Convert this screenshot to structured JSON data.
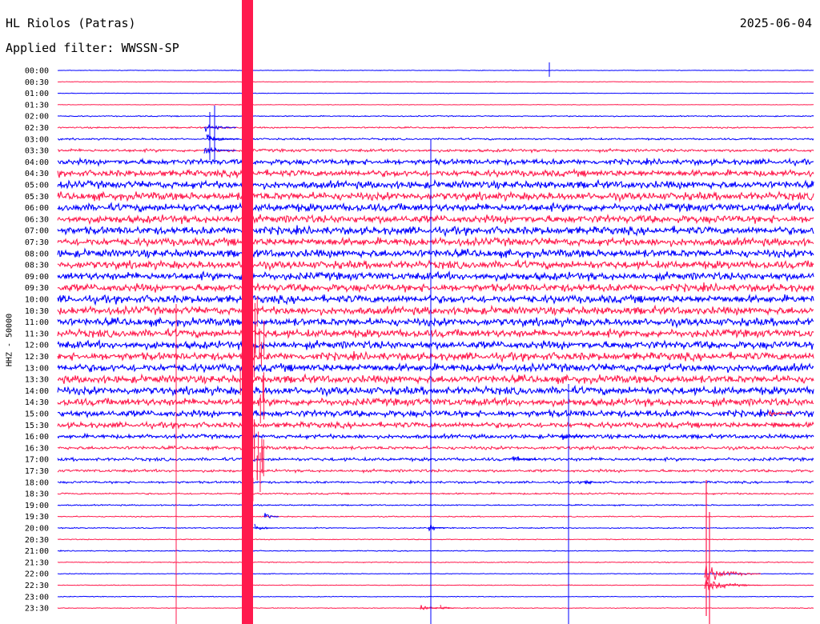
{
  "header": {
    "station": "HL Riolos (Patras)",
    "date": "2025-06-04",
    "filter_label": "Applied filter: WWSSN-SP",
    "channel_label": "HHZ - 50000"
  },
  "helicorder": {
    "interval_minutes": 30,
    "colors": {
      "even_line": "#0000ff",
      "odd_line": "#ff1a4d",
      "background": "#ffffff",
      "text": "#000000"
    },
    "rows": [
      {
        "time": "00:00",
        "noise": 0.3
      },
      {
        "time": "00:30",
        "noise": 0.3
      },
      {
        "time": "01:00",
        "noise": 0.3
      },
      {
        "time": "01:30",
        "noise": 0.3
      },
      {
        "time": "02:00",
        "noise": 0.6
      },
      {
        "time": "02:30",
        "noise": 0.8
      },
      {
        "time": "03:00",
        "noise": 1.0
      },
      {
        "time": "03:30",
        "noise": 1.6
      },
      {
        "time": "04:00",
        "noise": 3.0
      },
      {
        "time": "04:30",
        "noise": 3.5
      },
      {
        "time": "05:00",
        "noise": 4.0
      },
      {
        "time": "05:30",
        "noise": 4.2
      },
      {
        "time": "06:00",
        "noise": 4.2
      },
      {
        "time": "06:30",
        "noise": 4.2
      },
      {
        "time": "07:00",
        "noise": 4.2
      },
      {
        "time": "07:30",
        "noise": 4.2
      },
      {
        "time": "08:00",
        "noise": 4.2
      },
      {
        "time": "08:30",
        "noise": 4.2
      },
      {
        "time": "09:00",
        "noise": 4.2
      },
      {
        "time": "09:30",
        "noise": 4.2
      },
      {
        "time": "10:00",
        "noise": 4.2
      },
      {
        "time": "10:30",
        "noise": 4.2
      },
      {
        "time": "11:00",
        "noise": 4.2
      },
      {
        "time": "11:30",
        "noise": 4.2
      },
      {
        "time": "12:00",
        "noise": 4.2
      },
      {
        "time": "12:30",
        "noise": 4.2
      },
      {
        "time": "13:00",
        "noise": 4.2
      },
      {
        "time": "13:30",
        "noise": 4.2
      },
      {
        "time": "14:00",
        "noise": 4.2
      },
      {
        "time": "14:30",
        "noise": 4.0
      },
      {
        "time": "15:00",
        "noise": 3.6
      },
      {
        "time": "15:30",
        "noise": 3.0
      },
      {
        "time": "16:00",
        "noise": 2.2
      },
      {
        "time": "16:30",
        "noise": 1.8
      },
      {
        "time": "17:00",
        "noise": 1.8
      },
      {
        "time": "17:30",
        "noise": 1.5
      },
      {
        "time": "18:00",
        "noise": 1.2
      },
      {
        "time": "18:30",
        "noise": 0.9
      },
      {
        "time": "19:00",
        "noise": 0.7
      },
      {
        "time": "19:30",
        "noise": 0.6
      },
      {
        "time": "20:00",
        "noise": 0.6
      },
      {
        "time": "20:30",
        "noise": 0.5
      },
      {
        "time": "21:00",
        "noise": 0.5
      },
      {
        "time": "21:30",
        "noise": 0.5
      },
      {
        "time": "22:00",
        "noise": 0.4
      },
      {
        "time": "22:30",
        "noise": 0.4
      },
      {
        "time": "23:00",
        "noise": 0.4
      },
      {
        "time": "23:30",
        "noise": 0.4
      }
    ]
  }
}
